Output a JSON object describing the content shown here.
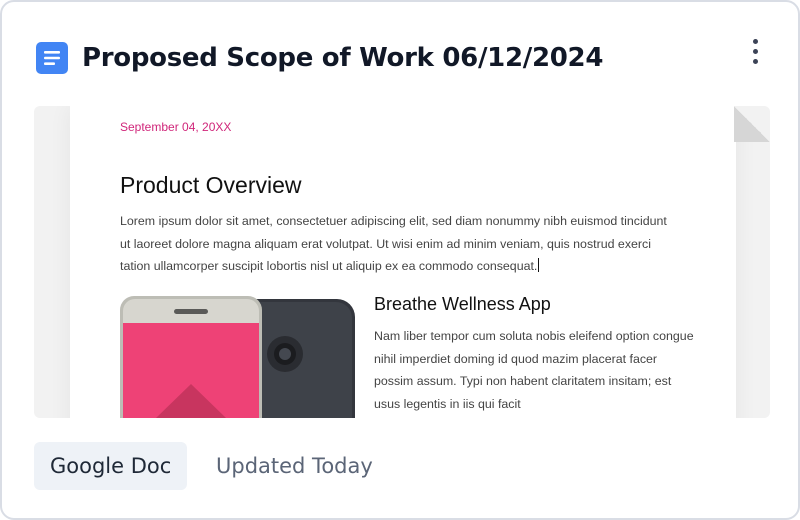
{
  "card": {
    "title": "Proposed Scope of Work 06/12/2024",
    "icon": "google-docs-icon",
    "menu_icon": "more-vertical-icon",
    "accent_color": "#4285f4"
  },
  "preview": {
    "date": "September 04, 20XX",
    "heading": "Product Overview",
    "paragraph": "Lorem ipsum dolor sit amet, consectetuer adipiscing elit, sed diam nonummy nibh euismod tincidunt ut laoreet dolore magna aliquam erat volutpat. Ut wisi enim ad minim veniam, quis nostrud exerci tation ullamcorper suscipit lobortis nisl ut aliquip ex ea commodo consequat.",
    "subheading": "Breathe Wellness App",
    "subparagraph": "Nam liber tempor cum soluta nobis eleifend option congue nihil imperdiet doming id quod mazim placerat facer possim assum. Typi non habent claritatem insitam; est usus legentis in iis qui facit",
    "date_color": "#d0267a",
    "illustration": "phone-illustration"
  },
  "footer": {
    "type_label": "Google Doc",
    "updated_label": "Updated Today"
  }
}
